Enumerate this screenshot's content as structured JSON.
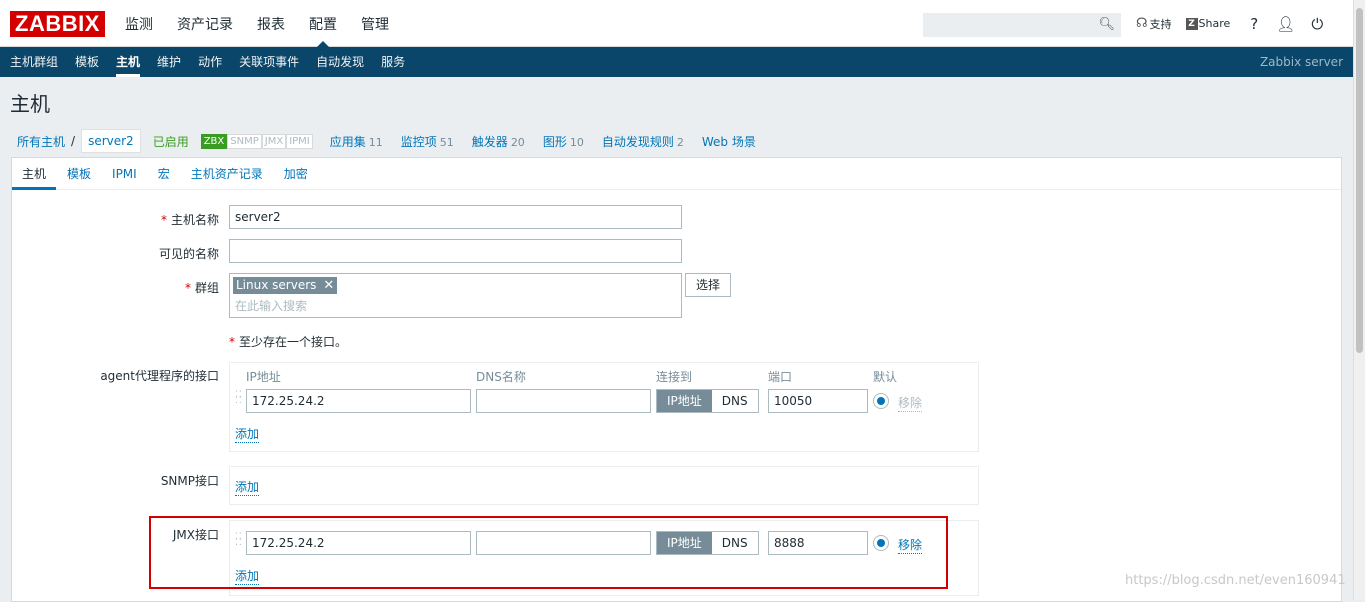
{
  "app": {
    "logo": "ZABBIX",
    "server_name": "Zabbix server"
  },
  "main_menu": [
    {
      "label": "监测",
      "active": false
    },
    {
      "label": "资产记录",
      "active": false
    },
    {
      "label": "报表",
      "active": false
    },
    {
      "label": "配置",
      "active": true
    },
    {
      "label": "管理",
      "active": false
    }
  ],
  "search": {
    "placeholder": ""
  },
  "top_icons": {
    "support": "支持",
    "share": "Share",
    "help": "?"
  },
  "sub_menu": [
    {
      "label": "主机群组",
      "active": false
    },
    {
      "label": "模板",
      "active": false
    },
    {
      "label": "主机",
      "active": true
    },
    {
      "label": "维护",
      "active": false
    },
    {
      "label": "动作",
      "active": false
    },
    {
      "label": "关联项事件",
      "active": false
    },
    {
      "label": "自动发现",
      "active": false
    },
    {
      "label": "服务",
      "active": false
    }
  ],
  "page_title": "主机",
  "host_nav": {
    "all_hosts": "所有主机",
    "separator": "/",
    "current_host": "server2",
    "status": "已启用",
    "availability": [
      {
        "label": "ZBX",
        "on": true
      },
      {
        "label": "SNMP",
        "on": false
      },
      {
        "label": "JMX",
        "on": false
      },
      {
        "label": "IPMI",
        "on": false
      }
    ],
    "items": [
      {
        "label": "应用集",
        "count": "11"
      },
      {
        "label": "监控项",
        "count": "51"
      },
      {
        "label": "触发器",
        "count": "20"
      },
      {
        "label": "图形",
        "count": "10"
      },
      {
        "label": "自动发现规则",
        "count": "2"
      },
      {
        "label": "Web 场景",
        "count": ""
      }
    ]
  },
  "tabs": [
    {
      "label": "主机",
      "active": true
    },
    {
      "label": "模板",
      "active": false
    },
    {
      "label": "IPMI",
      "active": false
    },
    {
      "label": "宏",
      "active": false
    },
    {
      "label": "主机资产记录",
      "active": false
    },
    {
      "label": "加密",
      "active": false
    }
  ],
  "form": {
    "required_mark": "*",
    "host_name_label": "主机名称",
    "host_name_value": "server2",
    "visible_name_label": "可见的名称",
    "visible_name_value": "",
    "groups_label": "群组",
    "group_tag": "Linux servers",
    "group_placeholder": "在此输入搜索",
    "select_button": "选择",
    "note_text": "至少存在一个接口。",
    "agent_label": "agent代理程序的接口",
    "snmp_label": "SNMP接口",
    "jmx_label": "JMX接口",
    "col_ip": "IP地址",
    "col_dns": "DNS名称",
    "col_connect": "连接到",
    "col_port": "端口",
    "col_default": "默认",
    "agent_ip": "172.25.24.2",
    "agent_dns": "",
    "agent_port": "10050",
    "jmx_ip": "172.25.24.2",
    "jmx_dns": "",
    "jmx_port": "8888",
    "seg_ip": "IP地址",
    "seg_dns": "DNS",
    "remove": "移除",
    "add": "添加"
  },
  "watermark": "https://blog.csdn.net/even160941"
}
